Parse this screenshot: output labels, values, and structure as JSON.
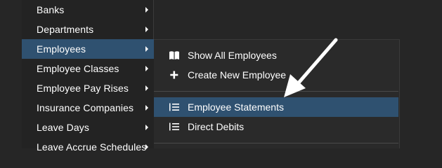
{
  "left_menu": {
    "items": [
      {
        "label": "Banks"
      },
      {
        "label": "Departments"
      },
      {
        "label": "Employees"
      },
      {
        "label": "Employee Classes"
      },
      {
        "label": "Employee Pay Rises"
      },
      {
        "label": "Insurance Companies"
      },
      {
        "label": "Leave Days"
      },
      {
        "label": "Leave Accrue Schedules"
      }
    ],
    "active_index": 2
  },
  "submenu": {
    "items": [
      {
        "label": "Show All Employees",
        "icon": "book-icon"
      },
      {
        "label": "Create New Employee",
        "icon": "plus-icon"
      },
      {
        "label": "Employee Statements",
        "icon": "list-ordered-icon"
      },
      {
        "label": "Direct Debits",
        "icon": "list-ordered-icon"
      }
    ],
    "active_index": 2
  },
  "colors": {
    "background": "#262626",
    "menu_background": "#232323",
    "highlight": "#2f5170",
    "text": "#ffffff"
  }
}
